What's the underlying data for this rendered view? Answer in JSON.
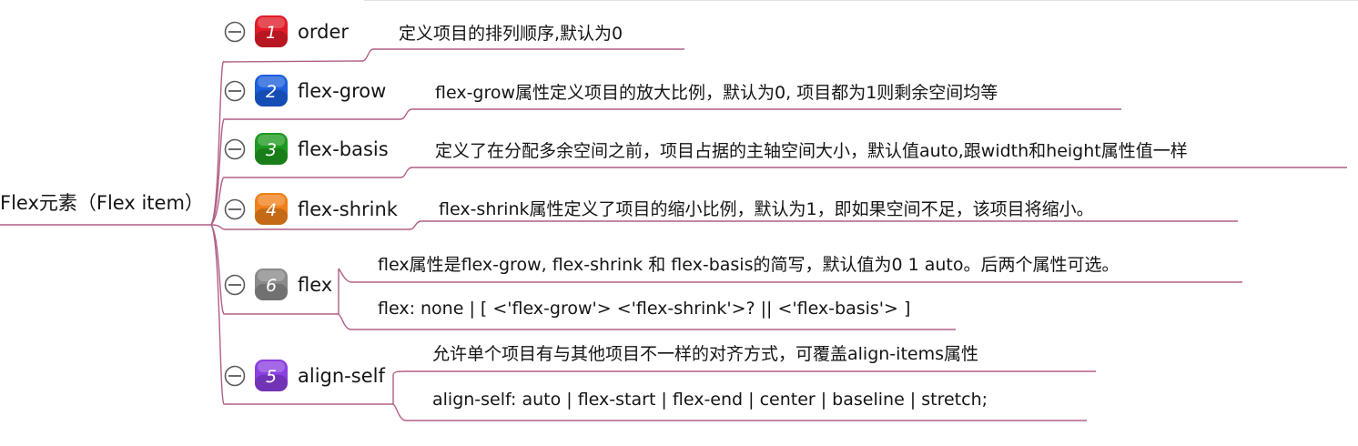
{
  "root": {
    "label": "Flex元素（Flex item）"
  },
  "branches": [
    {
      "badge": "1",
      "badge_color": "#e11c28",
      "label": "order",
      "notes": [
        "定义项目的排列顺序,默认为0"
      ]
    },
    {
      "badge": "2",
      "badge_color": "#1b5fdc",
      "label": "flex-grow",
      "notes": [
        "flex-grow属性定义项目的放大比例，默认为0, 项目都为1则剩余空间均等"
      ]
    },
    {
      "badge": "3",
      "badge_color": "#1f9a20",
      "label": "flex-basis",
      "notes": [
        "定义了在分配多余空间之前，项目占据的主轴空间大小，默认值auto,跟width和height属性值一样"
      ]
    },
    {
      "badge": "4",
      "badge_color": "#f0801c",
      "label": "flex-shrink",
      "notes": [
        "flex-shrink属性定义了项目的缩小比例，默认为1，即如果空间不足，该项目将缩小。"
      ]
    },
    {
      "badge": "6",
      "badge_color": "#8a8a8a",
      "label": "flex",
      "notes": [
        "flex属性是flex-grow, flex-shrink 和 flex-basis的简写，默认值为0 1 auto。后两个属性可选。",
        "flex: none | [ <'flex-grow'> <'flex-shrink'>? || <'flex-basis'> ]"
      ]
    },
    {
      "badge": "5",
      "badge_color": "#8b3fe0",
      "label": "align-self",
      "notes": [
        "允许单个项目有与其他项目不一样的对齐方式，可覆盖align-items属性",
        "align-self: auto | flex-start | flex-end | center | baseline | stretch;"
      ]
    }
  ]
}
